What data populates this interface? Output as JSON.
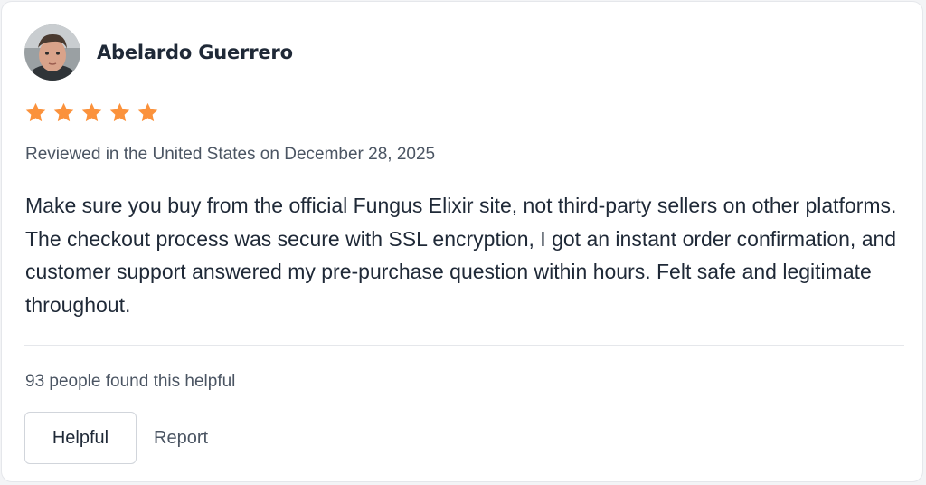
{
  "review": {
    "reviewer_name": "Abelardo Guerrero",
    "rating": 5,
    "max_rating": 5,
    "meta": "Reviewed in the United States on December 28, 2025",
    "body": "Make sure you buy from the official Fungus Elixir site, not third-party sellers on other platforms. The checkout process was secure with SSL encryption, I got an instant order confirmation, and customer support answered my pre-purchase question within hours. Felt safe and legitimate throughout.",
    "helpful_count_text": "93 people found this helpful"
  },
  "actions": {
    "helpful_label": "Helpful",
    "report_label": "Report"
  },
  "colors": {
    "star": "#fb923c",
    "text_primary": "#1f2937",
    "text_secondary": "#4b5563",
    "border": "#e5e7eb"
  },
  "icons": {
    "avatar": "reviewer-avatar-photo",
    "star": "star-icon"
  }
}
